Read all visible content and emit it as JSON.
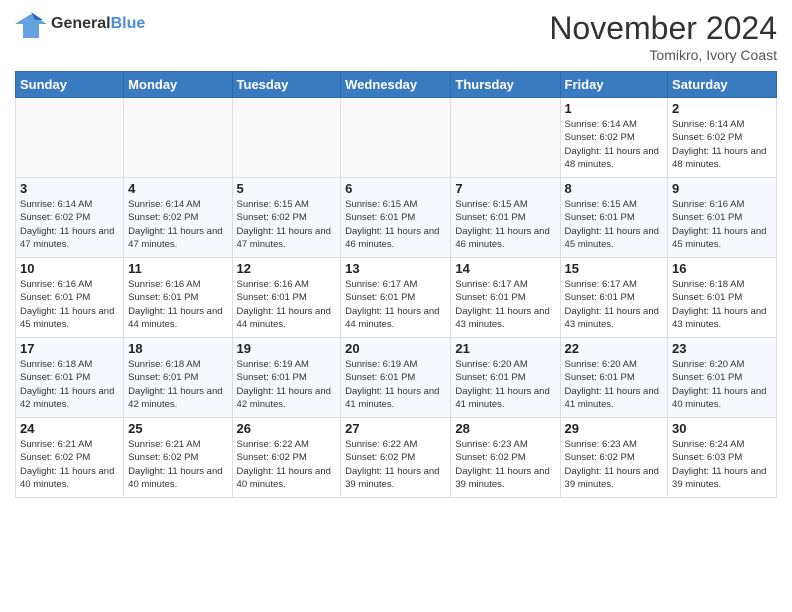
{
  "header": {
    "logo_general": "General",
    "logo_blue": "Blue",
    "month_title": "November 2024",
    "location": "Tomikro, Ivory Coast"
  },
  "days_of_week": [
    "Sunday",
    "Monday",
    "Tuesday",
    "Wednesday",
    "Thursday",
    "Friday",
    "Saturday"
  ],
  "weeks": [
    [
      {
        "day": "",
        "info": ""
      },
      {
        "day": "",
        "info": ""
      },
      {
        "day": "",
        "info": ""
      },
      {
        "day": "",
        "info": ""
      },
      {
        "day": "",
        "info": ""
      },
      {
        "day": "1",
        "info": "Sunrise: 6:14 AM\nSunset: 6:02 PM\nDaylight: 11 hours\nand 48 minutes."
      },
      {
        "day": "2",
        "info": "Sunrise: 6:14 AM\nSunset: 6:02 PM\nDaylight: 11 hours\nand 48 minutes."
      }
    ],
    [
      {
        "day": "3",
        "info": "Sunrise: 6:14 AM\nSunset: 6:02 PM\nDaylight: 11 hours\nand 47 minutes."
      },
      {
        "day": "4",
        "info": "Sunrise: 6:14 AM\nSunset: 6:02 PM\nDaylight: 11 hours\nand 47 minutes."
      },
      {
        "day": "5",
        "info": "Sunrise: 6:15 AM\nSunset: 6:02 PM\nDaylight: 11 hours\nand 47 minutes."
      },
      {
        "day": "6",
        "info": "Sunrise: 6:15 AM\nSunset: 6:01 PM\nDaylight: 11 hours\nand 46 minutes."
      },
      {
        "day": "7",
        "info": "Sunrise: 6:15 AM\nSunset: 6:01 PM\nDaylight: 11 hours\nand 46 minutes."
      },
      {
        "day": "8",
        "info": "Sunrise: 6:15 AM\nSunset: 6:01 PM\nDaylight: 11 hours\nand 45 minutes."
      },
      {
        "day": "9",
        "info": "Sunrise: 6:16 AM\nSunset: 6:01 PM\nDaylight: 11 hours\nand 45 minutes."
      }
    ],
    [
      {
        "day": "10",
        "info": "Sunrise: 6:16 AM\nSunset: 6:01 PM\nDaylight: 11 hours\nand 45 minutes."
      },
      {
        "day": "11",
        "info": "Sunrise: 6:16 AM\nSunset: 6:01 PM\nDaylight: 11 hours\nand 44 minutes."
      },
      {
        "day": "12",
        "info": "Sunrise: 6:16 AM\nSunset: 6:01 PM\nDaylight: 11 hours\nand 44 minutes."
      },
      {
        "day": "13",
        "info": "Sunrise: 6:17 AM\nSunset: 6:01 PM\nDaylight: 11 hours\nand 44 minutes."
      },
      {
        "day": "14",
        "info": "Sunrise: 6:17 AM\nSunset: 6:01 PM\nDaylight: 11 hours\nand 43 minutes."
      },
      {
        "day": "15",
        "info": "Sunrise: 6:17 AM\nSunset: 6:01 PM\nDaylight: 11 hours\nand 43 minutes."
      },
      {
        "day": "16",
        "info": "Sunrise: 6:18 AM\nSunset: 6:01 PM\nDaylight: 11 hours\nand 43 minutes."
      }
    ],
    [
      {
        "day": "17",
        "info": "Sunrise: 6:18 AM\nSunset: 6:01 PM\nDaylight: 11 hours\nand 42 minutes."
      },
      {
        "day": "18",
        "info": "Sunrise: 6:18 AM\nSunset: 6:01 PM\nDaylight: 11 hours\nand 42 minutes."
      },
      {
        "day": "19",
        "info": "Sunrise: 6:19 AM\nSunset: 6:01 PM\nDaylight: 11 hours\nand 42 minutes."
      },
      {
        "day": "20",
        "info": "Sunrise: 6:19 AM\nSunset: 6:01 PM\nDaylight: 11 hours\nand 41 minutes."
      },
      {
        "day": "21",
        "info": "Sunrise: 6:20 AM\nSunset: 6:01 PM\nDaylight: 11 hours\nand 41 minutes."
      },
      {
        "day": "22",
        "info": "Sunrise: 6:20 AM\nSunset: 6:01 PM\nDaylight: 11 hours\nand 41 minutes."
      },
      {
        "day": "23",
        "info": "Sunrise: 6:20 AM\nSunset: 6:01 PM\nDaylight: 11 hours\nand 40 minutes."
      }
    ],
    [
      {
        "day": "24",
        "info": "Sunrise: 6:21 AM\nSunset: 6:02 PM\nDaylight: 11 hours\nand 40 minutes."
      },
      {
        "day": "25",
        "info": "Sunrise: 6:21 AM\nSunset: 6:02 PM\nDaylight: 11 hours\nand 40 minutes."
      },
      {
        "day": "26",
        "info": "Sunrise: 6:22 AM\nSunset: 6:02 PM\nDaylight: 11 hours\nand 40 minutes."
      },
      {
        "day": "27",
        "info": "Sunrise: 6:22 AM\nSunset: 6:02 PM\nDaylight: 11 hours\nand 39 minutes."
      },
      {
        "day": "28",
        "info": "Sunrise: 6:23 AM\nSunset: 6:02 PM\nDaylight: 11 hours\nand 39 minutes."
      },
      {
        "day": "29",
        "info": "Sunrise: 6:23 AM\nSunset: 6:02 PM\nDaylight: 11 hours\nand 39 minutes."
      },
      {
        "day": "30",
        "info": "Sunrise: 6:24 AM\nSunset: 6:03 PM\nDaylight: 11 hours\nand 39 minutes."
      }
    ]
  ]
}
